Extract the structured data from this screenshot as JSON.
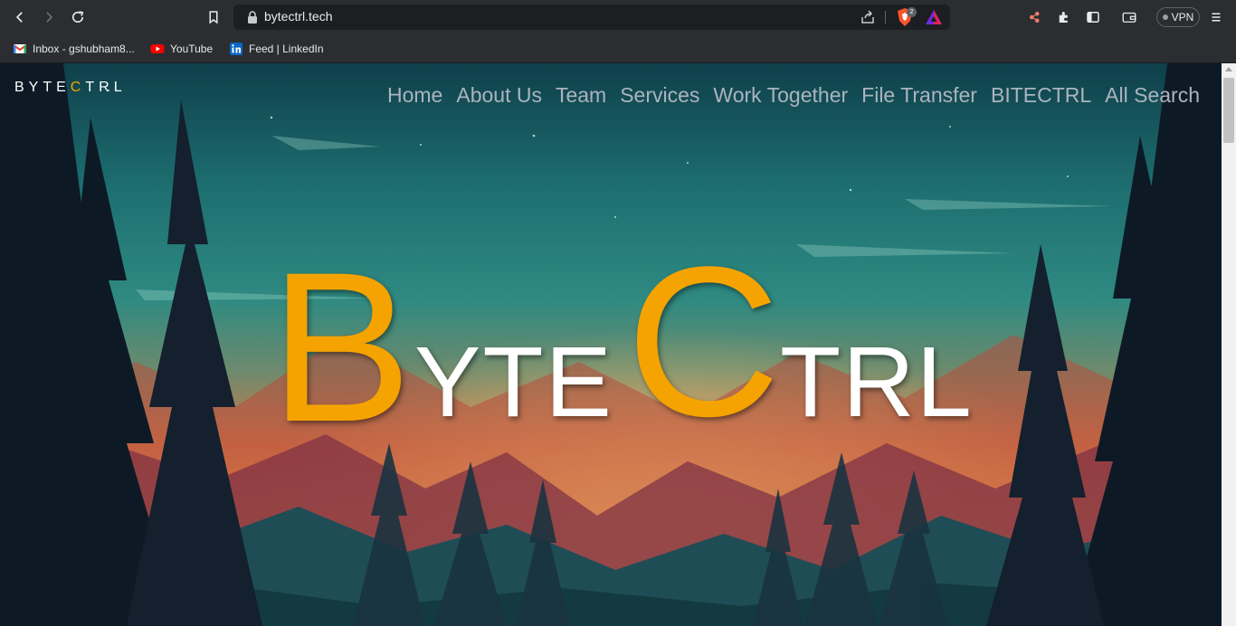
{
  "browser": {
    "url": "bytectrl.tech",
    "shield_count": "2",
    "vpn_label": "VPN",
    "icons": [
      "back-icon",
      "forward-icon",
      "reload-icon",
      "bookmark-icon",
      "lock-icon",
      "share-icon",
      "brave-shield-icon",
      "brave-rewards-icon",
      "leo-icon",
      "extensions-icon",
      "sidebar-icon",
      "wallet-icon",
      "menu-icon"
    ]
  },
  "bookmarks": [
    {
      "label": "Inbox - gshubham8...",
      "icon": "gmail-icon"
    },
    {
      "label": "YouTube",
      "icon": "youtube-icon"
    },
    {
      "label": "Feed | LinkedIn",
      "icon": "linkedin-icon"
    }
  ],
  "site": {
    "logo": {
      "p1": "BYTE",
      "p2": "C",
      "p3": "TRL"
    },
    "nav": [
      "Home",
      "About Us",
      "Team",
      "Services",
      "Work Together",
      "File Transfer",
      "BITECTRL",
      "All Search"
    ],
    "headline": {
      "l1": "B",
      "l2": "YTE",
      "l3": "C",
      "l4": "TRL"
    }
  },
  "colors": {
    "accent": "#f5a300",
    "nav_text": "#aab4bf",
    "chrome": "#2b2d31"
  }
}
